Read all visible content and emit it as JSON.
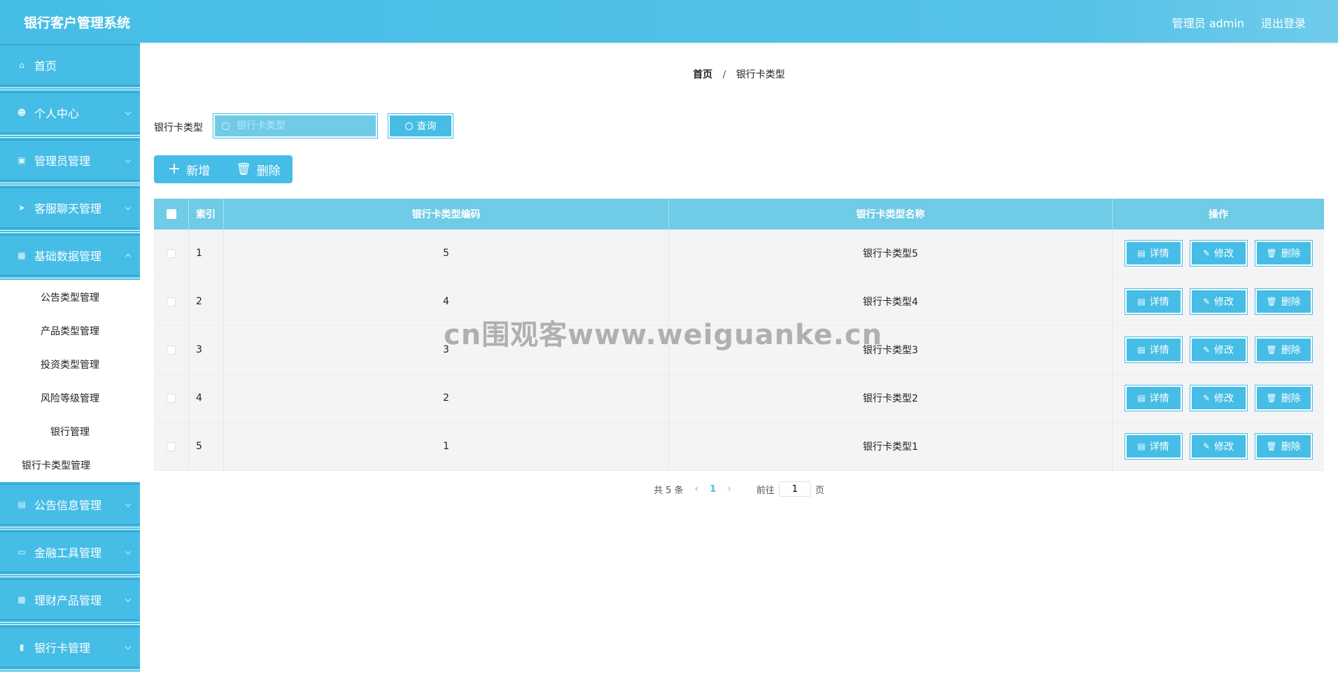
{
  "header": {
    "title": "银行客户管理系统",
    "user_label": "管理员 admin",
    "logout_label": "退出登录"
  },
  "sidebar": {
    "items": [
      {
        "label": "首页",
        "icon": "home-icon"
      },
      {
        "label": "个人中心",
        "icon": "user-icon"
      },
      {
        "label": "管理员管理",
        "icon": "chart-icon"
      },
      {
        "label": "客服聊天管理",
        "icon": "send-icon"
      },
      {
        "label": "基础数据管理",
        "icon": "grid-icon"
      }
    ],
    "submenu": [
      "公告类型管理",
      "产品类型管理",
      "投资类型管理",
      "风险等级管理",
      "银行管理",
      "银行卡类型管理"
    ],
    "items_after": [
      {
        "label": "公告信息管理",
        "icon": "clipboard-icon"
      },
      {
        "label": "金融工具管理",
        "icon": "monitor-icon"
      },
      {
        "label": "理财产品管理",
        "icon": "grid-icon"
      },
      {
        "label": "银行卡管理",
        "icon": "ticket-icon"
      }
    ]
  },
  "breadcrumb": {
    "home": "首页",
    "separator": "/",
    "current": "银行卡类型"
  },
  "search": {
    "label": "银行卡类型",
    "placeholder": "银行卡类型",
    "button": "查询"
  },
  "actions": {
    "add": "新增",
    "delete": "删除"
  },
  "table": {
    "headers": {
      "index": "索引",
      "code": "银行卡类型编码",
      "name": "银行卡类型名称",
      "ops": "操作"
    },
    "op_labels": {
      "detail": "详情",
      "edit": "修改",
      "delete": "删除"
    },
    "rows": [
      {
        "index": "1",
        "code": "5",
        "name": "银行卡类型5"
      },
      {
        "index": "2",
        "code": "4",
        "name": "银行卡类型4"
      },
      {
        "index": "3",
        "code": "3",
        "name": "银行卡类型3"
      },
      {
        "index": "4",
        "code": "2",
        "name": "银行卡类型2"
      },
      {
        "index": "5",
        "code": "1",
        "name": "银行卡类型1"
      }
    ]
  },
  "pagination": {
    "total": "共 5 条",
    "current_page": "1",
    "goto_label": "前往",
    "goto_value": "1",
    "page_unit": "页"
  },
  "watermark": "cn围观客www.weiguanke.cn",
  "colors": {
    "primary": "#45bde6",
    "header_light": "#6fcbe6"
  }
}
